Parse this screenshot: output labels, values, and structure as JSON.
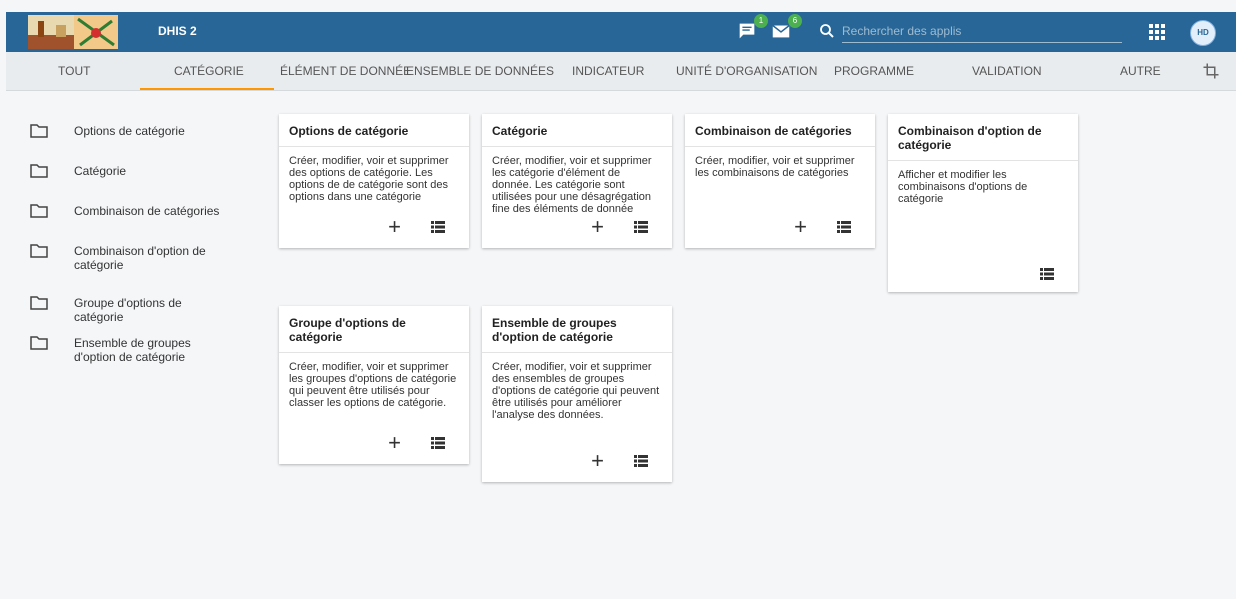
{
  "header": {
    "app_title": "DHIS 2",
    "messages_badge": "1",
    "mail_badge": "6",
    "search_placeholder": "Rechercher des applis",
    "avatar_initials": "HD",
    "bg_color": "#276696"
  },
  "tabs": [
    {
      "label": "TOUT"
    },
    {
      "label": "CATÉGORIE"
    },
    {
      "label": "ÉLÉMENT DE DONNÉE"
    },
    {
      "label": "ENSEMBLE DE DONNÉES"
    },
    {
      "label": "INDICATEUR"
    },
    {
      "label": "UNITÉ D'ORGANISATION"
    },
    {
      "label": "PROGRAMME"
    },
    {
      "label": "VALIDATION"
    },
    {
      "label": "AUTRE"
    }
  ],
  "active_tab": "CATÉGORIE",
  "sidebar": {
    "items": [
      {
        "label": "Options de catégorie",
        "icon": "folder-icon"
      },
      {
        "label": "Catégorie",
        "icon": "folder-icon"
      },
      {
        "label": "Combinaison de catégories",
        "icon": "folder-icon"
      },
      {
        "label": "Combinaison d'option de catégorie",
        "icon": "folder-icon"
      },
      {
        "label": "Groupe d'options de catégorie",
        "icon": "folder-icon"
      },
      {
        "label": "Ensemble de groupes d'option de catégorie",
        "icon": "folder-icon"
      }
    ]
  },
  "cards": [
    {
      "title": "Options de catégorie",
      "description": "Créer, modifier, voir et supprimer des options de catégorie. Les options de de catégorie sont des options dans une catégorie",
      "add": true
    },
    {
      "title": "Catégorie",
      "description": "Créer, modifier, voir et supprimer les catégorie d'élément de donnée. Les catégorie sont utilisées pour une désagrégation fine des éléments de donnée",
      "add": true
    },
    {
      "title": "Combinaison de catégories",
      "description": "Créer, modifier, voir et supprimer les combinaisons de catégories",
      "add": true
    },
    {
      "title": "Combinaison d'option de catégorie",
      "description": "Afficher et modifier les combinaisons d'options de catégorie",
      "add": false
    },
    {
      "title": "Groupe d'options de catégorie",
      "description": "Créer, modifier, voir et supprimer les groupes d'options de catégorie qui peuvent être utilisés pour classer les options de catégorie.",
      "add": true
    },
    {
      "title": "Ensemble de groupes d'option de catégorie",
      "description": "Créer, modifier, voir et supprimer des ensembles de groupes d'options de catégorie qui peuvent être utilisés pour améliorer l'analyse des données.",
      "add": true
    }
  ],
  "add_glyph": "+",
  "colors": {
    "accent": "#ff9800",
    "header": "#276696",
    "badge": "#4caf50"
  }
}
